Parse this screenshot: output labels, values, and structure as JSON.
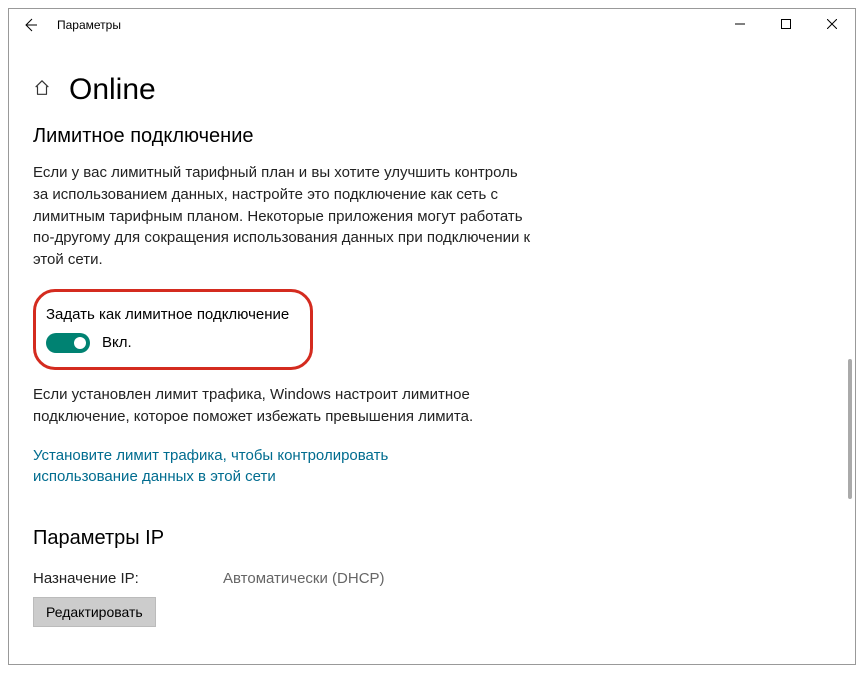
{
  "titlebar": {
    "title": "Параметры"
  },
  "page": {
    "title": "Online"
  },
  "metered": {
    "heading": "Лимитное подключение",
    "description": "Если у вас лимитный тарифный план и вы хотите улучшить контроль за использованием данных, настройте это подключение как сеть с лимитным тарифным планом. Некоторые приложения могут работать по-другому для сокращения использования данных при подключении к этой сети.",
    "toggle_label": "Задать как лимитное подключение",
    "toggle_state": "Вкл.",
    "limit_note": "Если установлен лимит трафика, Windows настроит лимитное подключение, которое поможет избежать превышения лимита.",
    "limit_link": "Установите лимит трафика, чтобы контролировать использование данных в этой сети"
  },
  "ip": {
    "heading": "Параметры IP",
    "assignment_label": "Назначение IP:",
    "assignment_value": "Автоматически (DHCP)",
    "edit_button": "Редактировать"
  }
}
